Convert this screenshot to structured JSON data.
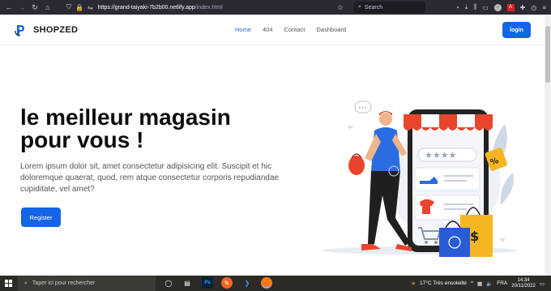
{
  "browser": {
    "url_host": "https://grand-taiyaki-7b2b00.netlify.app",
    "url_path": "/index.html",
    "search_placeholder": "Search"
  },
  "site": {
    "brand": "SHOPZED",
    "nav_links": [
      "Home",
      "404",
      "Contact",
      "Dashboard"
    ],
    "active_link": "Home",
    "login_label": "login"
  },
  "hero": {
    "title_line1": "le meilleur magasin",
    "title_line2": "pour vous !",
    "text": "Lorem ipsum dolor sit, amet consectetur adipisicing elit. Suscipit et hic doloremque quaerat, quod, rem atque consectetur corporis repudiandae cupiditate, vel amet?",
    "cta_label": "Register"
  },
  "colors": {
    "accent": "#1465e6",
    "awning_red": "#e8452c",
    "phone_frame": "#222222"
  },
  "taskbar": {
    "search_placeholder": "Taper ici pour rechercher",
    "weather": "17°C  Très ensoleillé",
    "language": "FRA",
    "time": "14:34",
    "date": "20/11/2022"
  }
}
